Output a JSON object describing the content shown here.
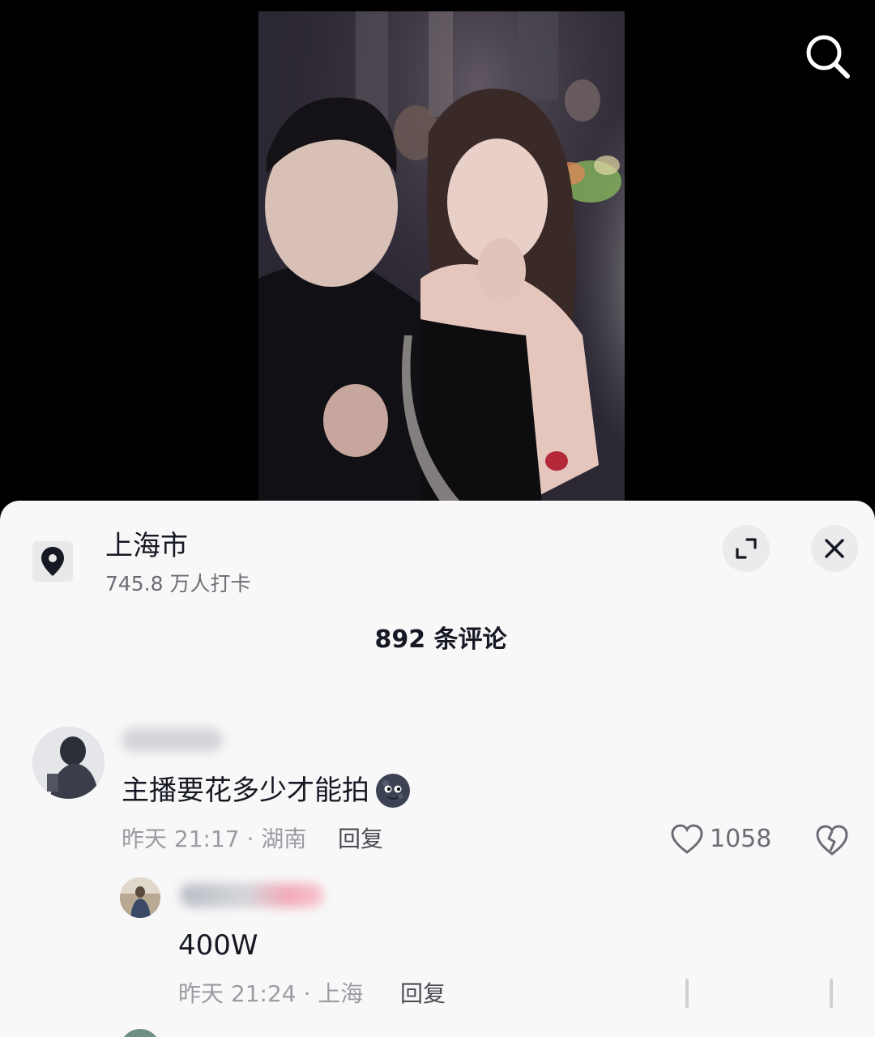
{
  "location": {
    "name": "上海市",
    "checkins": "745.8 万人打卡"
  },
  "comments_header": {
    "count_label": "892 条评论"
  },
  "comment": {
    "text": "主播要花多少才能拍",
    "time_location": "昨天 21:17 · 湖南",
    "reply_label": "回复",
    "like_count": "1058"
  },
  "reply": {
    "text": "400W",
    "time_location": "昨天 21:24 · 上海",
    "reply_label": "回复"
  },
  "icons": {
    "search": "search-icon",
    "location": "location-pin-icon",
    "expand": "expand-icon",
    "close": "close-icon",
    "like": "heart-outline-icon",
    "dislike": "broken-heart-icon",
    "emoji": "moon-face-emoji"
  },
  "colors": {
    "sheet_bg": "#f8f8f8",
    "primary_text": "#161823",
    "secondary_text": "#9a9ca3",
    "screen_bg": "#000000"
  }
}
